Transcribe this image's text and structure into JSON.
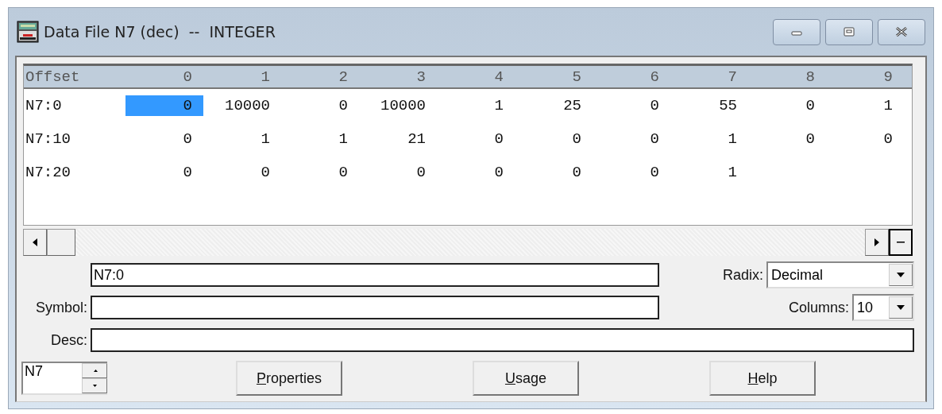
{
  "window": {
    "title": "Data File N7 (dec)  --  INTEGER"
  },
  "table": {
    "columns": [
      "Offset",
      "0",
      "1",
      "2",
      "3",
      "4",
      "5",
      "6",
      "7",
      "8",
      "9"
    ],
    "rows": [
      {
        "cells": [
          {
            "value": "N7:0",
            "selected": false
          },
          {
            "value": "0",
            "selected": true
          },
          {
            "value": "10000",
            "selected": false
          },
          {
            "value": "0",
            "selected": false
          },
          {
            "value": "10000",
            "selected": false
          },
          {
            "value": "1",
            "selected": false
          },
          {
            "value": "25",
            "selected": false
          },
          {
            "value": "0",
            "selected": false
          },
          {
            "value": "55",
            "selected": false
          },
          {
            "value": "0",
            "selected": false
          },
          {
            "value": "1",
            "selected": false
          }
        ]
      },
      {
        "cells": [
          {
            "value": "N7:10",
            "selected": false
          },
          {
            "value": "0",
            "selected": false
          },
          {
            "value": "1",
            "selected": false
          },
          {
            "value": "1",
            "selected": false
          },
          {
            "value": "21",
            "selected": false
          },
          {
            "value": "0",
            "selected": false
          },
          {
            "value": "0",
            "selected": false
          },
          {
            "value": "0",
            "selected": false
          },
          {
            "value": "1",
            "selected": false
          },
          {
            "value": "0",
            "selected": false
          },
          {
            "value": "0",
            "selected": false
          }
        ]
      },
      {
        "cells": [
          {
            "value": "N7:20",
            "selected": false
          },
          {
            "value": "0",
            "selected": false
          },
          {
            "value": "0",
            "selected": false
          },
          {
            "value": "0",
            "selected": false
          },
          {
            "value": "0",
            "selected": false
          },
          {
            "value": "0",
            "selected": false
          },
          {
            "value": "0",
            "selected": false
          },
          {
            "value": "0",
            "selected": false
          },
          {
            "value": "1",
            "selected": false
          }
        ]
      }
    ]
  },
  "address": {
    "value": "N7:0"
  },
  "symbol": {
    "label": "Symbol:"
  },
  "desc": {
    "label": "Desc:"
  },
  "radix": {
    "label": "Radix:",
    "value": "Decimal"
  },
  "columns_select": {
    "label": "Columns:",
    "value": "10"
  },
  "file_spinner": {
    "value": "N7"
  },
  "buttons": [
    "Properties",
    "Usage",
    "Help"
  ]
}
